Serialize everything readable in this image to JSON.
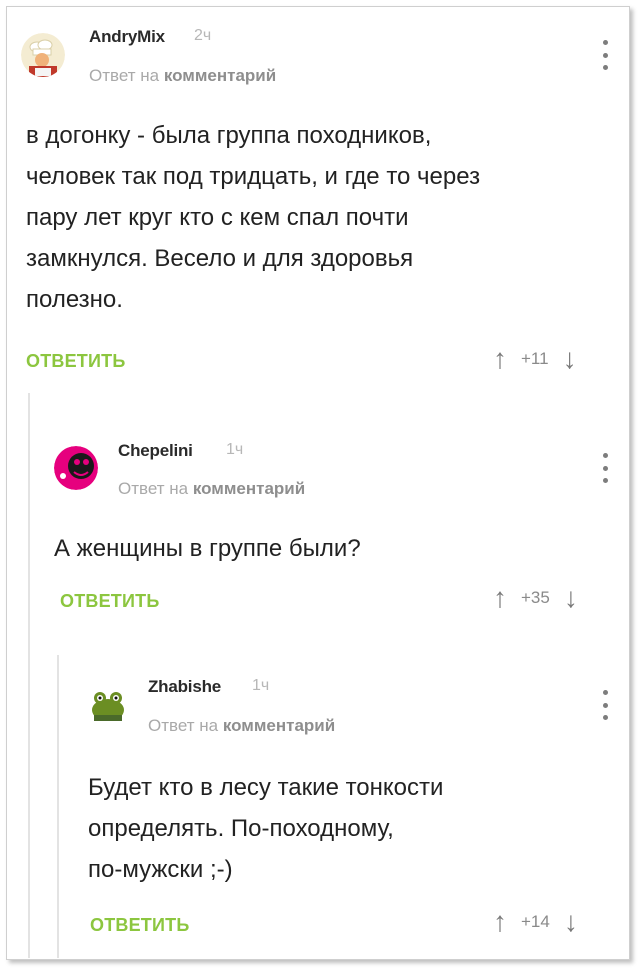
{
  "comments": [
    {
      "author": "AndryMix",
      "time": "2ч",
      "reply_prefix": "Ответ на",
      "reply_target": "комментарий",
      "text": "в догонку - была группа походников,\nчеловек так под тридцать, и где то через\nпару лет круг кто с кем спал почти\nзамкнулся. Весело и для здоровья\nполезно.",
      "reply_label": "ОТВЕТИТЬ",
      "score": "+11",
      "avatar_icon": "chef-avatar"
    },
    {
      "author": "Chepelini",
      "time": "1ч",
      "reply_prefix": "Ответ на",
      "reply_target": "комментарий",
      "text": "А женщины в группе были?",
      "reply_label": "ОТВЕТИТЬ",
      "score": "+35",
      "avatar_icon": "pink-face-avatar"
    },
    {
      "author": "Zhabishe",
      "time": "1ч",
      "reply_prefix": "Ответ на",
      "reply_target": "комментарий",
      "text": "Будет кто в лесу такие тонкости\nопределять. По-походному,\nпо-мужски ;-)",
      "reply_label": "ОТВЕТИТЬ",
      "score": "+14",
      "avatar_icon": "frog-avatar"
    }
  ],
  "colors": {
    "accent": "#8cc63f",
    "muted": "#a9a9a9",
    "text": "#222222"
  },
  "icons": {
    "upvote": "↑",
    "downvote": "↓"
  }
}
